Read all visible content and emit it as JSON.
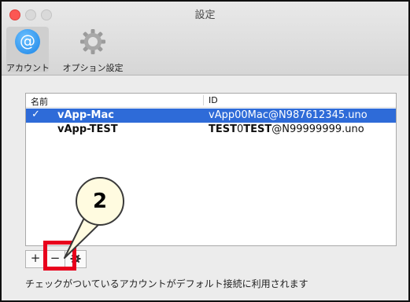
{
  "window": {
    "title": "設定"
  },
  "toolbar": {
    "tabs": [
      {
        "label": "アカウント",
        "icon": "at-icon",
        "selected": true
      },
      {
        "label": "オプション設定",
        "icon": "gear-icon",
        "selected": false
      }
    ]
  },
  "table": {
    "columns": [
      "名前",
      "ID"
    ],
    "rows": [
      {
        "checked": true,
        "name": "vApp-Mac",
        "id": "vApp00Mac@N987612345.uno",
        "selected": true
      },
      {
        "checked": false,
        "name": "vApp-TEST",
        "id": "TEST0TEST@N99999999.uno",
        "selected": false
      }
    ]
  },
  "buttons": {
    "add": "+",
    "remove": "−"
  },
  "footer": {
    "note": "チェックがついているアカウントがデフォルト接続に利用されます"
  },
  "callout": {
    "number": "2"
  },
  "colors": {
    "selection": "#2e6bd8",
    "highlight_box": "#e8001c",
    "callout_fill": "#fffbe0",
    "at_icon": "#1a84e6"
  }
}
